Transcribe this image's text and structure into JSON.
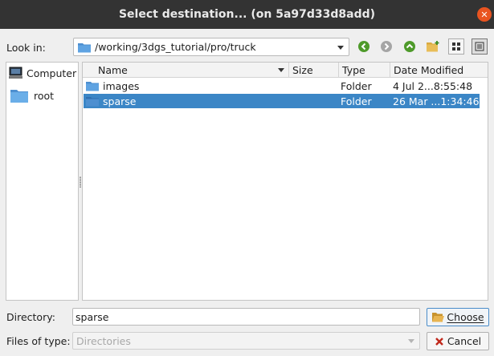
{
  "window": {
    "title": "Select destination... (on 5a97d33d8add)"
  },
  "look_in": {
    "label": "Look in:",
    "path": "/working/3dgs_tutorial/pro/truck"
  },
  "toolbar": {
    "back_icon": "arrow-left-circle-icon",
    "forward_icon": "arrow-right-circle-icon",
    "up_icon": "arrow-up-circle-icon",
    "new_folder_icon": "new-folder-icon",
    "list_view_icon": "list-view-icon",
    "detail_view_icon": "detail-view-icon"
  },
  "sidebar": {
    "items": [
      {
        "label": "Computer",
        "icon": "computer-icon"
      },
      {
        "label": "root",
        "icon": "folder-icon"
      }
    ]
  },
  "files": {
    "columns": [
      "Name",
      "Size",
      "Type",
      "Date Modified"
    ],
    "rows": [
      {
        "name": "images",
        "size": "",
        "type": "Folder",
        "date": "4 Jul 2...8:55:48",
        "selected": false
      },
      {
        "name": "sparse",
        "size": "",
        "type": "Folder",
        "date": "26 Mar ...1:34:46",
        "selected": true
      }
    ]
  },
  "directory": {
    "label": "Directory:",
    "value": "sparse"
  },
  "file_type": {
    "label": "Files of type:",
    "value": "Directories"
  },
  "buttons": {
    "choose": "Choose",
    "cancel": "Cancel"
  },
  "colors": {
    "titlebar": "#333333",
    "selection": "#3b86c6",
    "close": "#e95420",
    "folder": "#5a9bd8"
  }
}
